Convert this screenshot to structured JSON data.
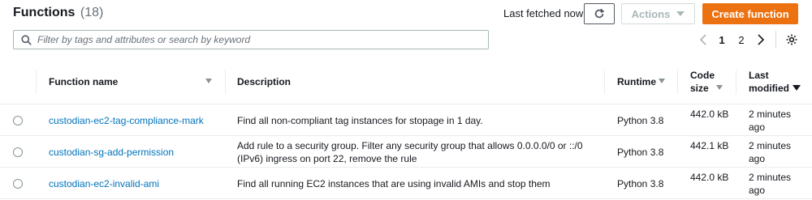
{
  "header": {
    "title": "Functions",
    "count": "(18)",
    "last_fetched": "Last fetched now",
    "actions_label": "Actions",
    "create_label": "Create function"
  },
  "search": {
    "placeholder": "Filter by tags and attributes or search by keyword",
    "value": ""
  },
  "pagination": {
    "pages": [
      "1",
      "2"
    ],
    "current": "1"
  },
  "table": {
    "columns": {
      "function_name": "Function name",
      "description": "Description",
      "runtime": "Runtime",
      "code_size": "Code size",
      "last_modified": "Last modified"
    },
    "rows": [
      {
        "name": "custodian-ec2-tag-compliance-mark",
        "description": "Find all non-compliant tag instances for stopage in 1 day.",
        "runtime": "Python 3.8",
        "code_size": "442.0 kB",
        "last_modified": "2 minutes ago"
      },
      {
        "name": "custodian-sg-add-permission",
        "description": "Add rule to a security group. Filter any security group that allows 0.0.0.0/0 or ::/0 (IPv6) ingress on port 22, remove the rule",
        "runtime": "Python 3.8",
        "code_size": "442.1 kB",
        "last_modified": "2 minutes ago"
      },
      {
        "name": "custodian-ec2-invalid-ami",
        "description": "Find all running EC2 instances that are using invalid AMIs and stop them",
        "runtime": "Python 3.8",
        "code_size": "442.0 kB",
        "last_modified": "2 minutes ago"
      }
    ]
  },
  "colors": {
    "primary": "#ec7211",
    "link": "#0073bb",
    "text": "#16191f",
    "muted": "#687078",
    "border": "#eaeded"
  },
  "icons": [
    "refresh-icon",
    "caret-down-icon",
    "search-icon",
    "chevron-left-icon",
    "chevron-right-icon",
    "settings-gear-icon",
    "sort-caret-icon",
    "sort-descending-icon"
  ]
}
